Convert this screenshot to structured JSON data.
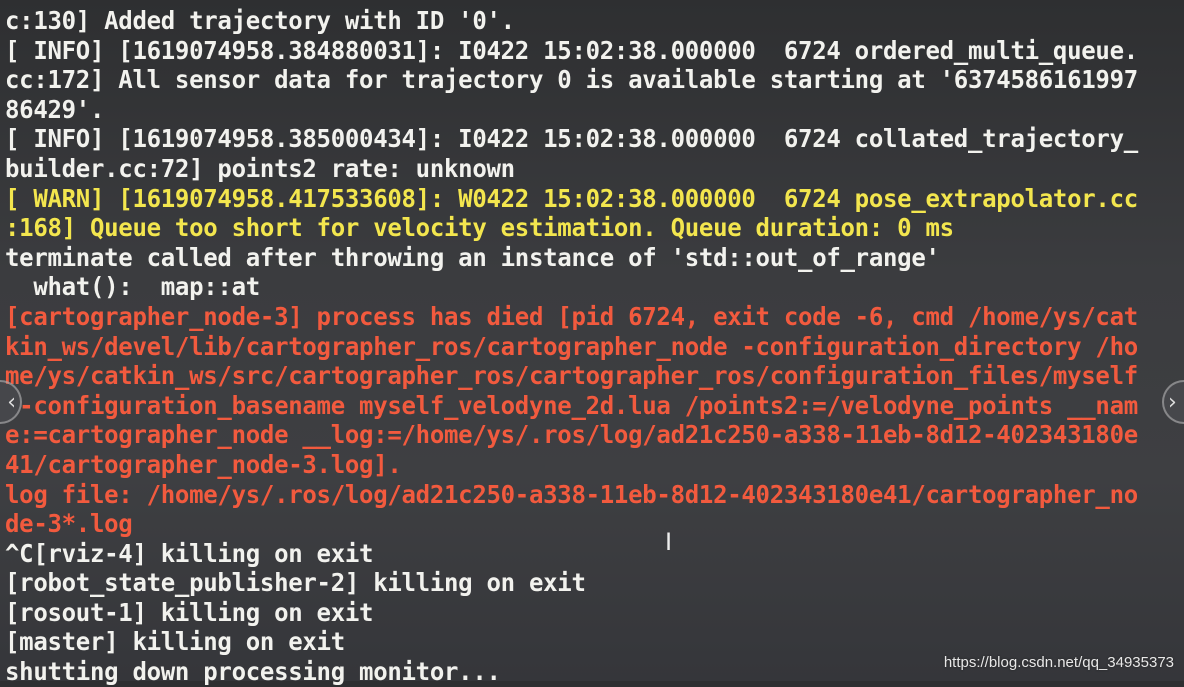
{
  "terminal": {
    "colors": {
      "background": "#3b3c3f",
      "info": "#f2f2ee",
      "warn": "#f3e64e",
      "error": "#f25a3e"
    },
    "lines": [
      {
        "text": "c:130] Added trajectory with ID '0'.",
        "level": "info"
      },
      {
        "text": "[ INFO] [1619074958.384880031]: I0422 15:02:38.000000  6724 ordered_multi_queue.",
        "level": "info"
      },
      {
        "text": "cc:172] All sensor data for trajectory 0 is available starting at '6374586161997",
        "level": "info"
      },
      {
        "text": "86429'.",
        "level": "info"
      },
      {
        "text": "[ INFO] [1619074958.385000434]: I0422 15:02:38.000000  6724 collated_trajectory_",
        "level": "info"
      },
      {
        "text": "builder.cc:72] points2 rate: unknown",
        "level": "info"
      },
      {
        "text": "[ WARN] [1619074958.417533608]: W0422 15:02:38.000000  6724 pose_extrapolator.cc",
        "level": "warn"
      },
      {
        "text": ":168] Queue too short for velocity estimation. Queue duration: 0 ms",
        "level": "warn"
      },
      {
        "text": "terminate called after throwing an instance of 'std::out_of_range'",
        "level": "info"
      },
      {
        "text": "  what():  map::at",
        "level": "info"
      },
      {
        "text": "[cartographer_node-3] process has died [pid 6724, exit code -6, cmd /home/ys/cat",
        "level": "err"
      },
      {
        "text": "kin_ws/devel/lib/cartographer_ros/cartographer_node -configuration_directory /ho",
        "level": "err"
      },
      {
        "text": "me/ys/catkin_ws/src/cartographer_ros/cartographer_ros/configuration_files/myself",
        "level": "err"
      },
      {
        "text": " -configuration_basename myself_velodyne_2d.lua /points2:=/velodyne_points __nam",
        "level": "err"
      },
      {
        "text": "e:=cartographer_node __log:=/home/ys/.ros/log/ad21c250-a338-11eb-8d12-402343180e",
        "level": "err"
      },
      {
        "text": "41/cartographer_node-3.log].",
        "level": "err"
      },
      {
        "text": "log file: /home/ys/.ros/log/ad21c250-a338-11eb-8d12-402343180e41/cartographer_no",
        "level": "err"
      },
      {
        "text": "de-3*.log",
        "level": "err"
      },
      {
        "text": "^C[rviz-4] killing on exit",
        "level": "info"
      },
      {
        "text": "[robot_state_publisher-2] killing on exit",
        "level": "info"
      },
      {
        "text": "[rosout-1] killing on exit",
        "level": "info"
      },
      {
        "text": "[master] killing on exit",
        "level": "info"
      },
      {
        "text": "shutting down processing monitor...",
        "level": "info"
      }
    ]
  },
  "viewer": {
    "prev_icon": "chevron-left-icon",
    "next_icon": "chevron-right-icon",
    "prev_glyph": "‹",
    "next_glyph": "›"
  },
  "cursor_glyph": "I",
  "watermark": "https://blog.csdn.net/qq_34935373"
}
